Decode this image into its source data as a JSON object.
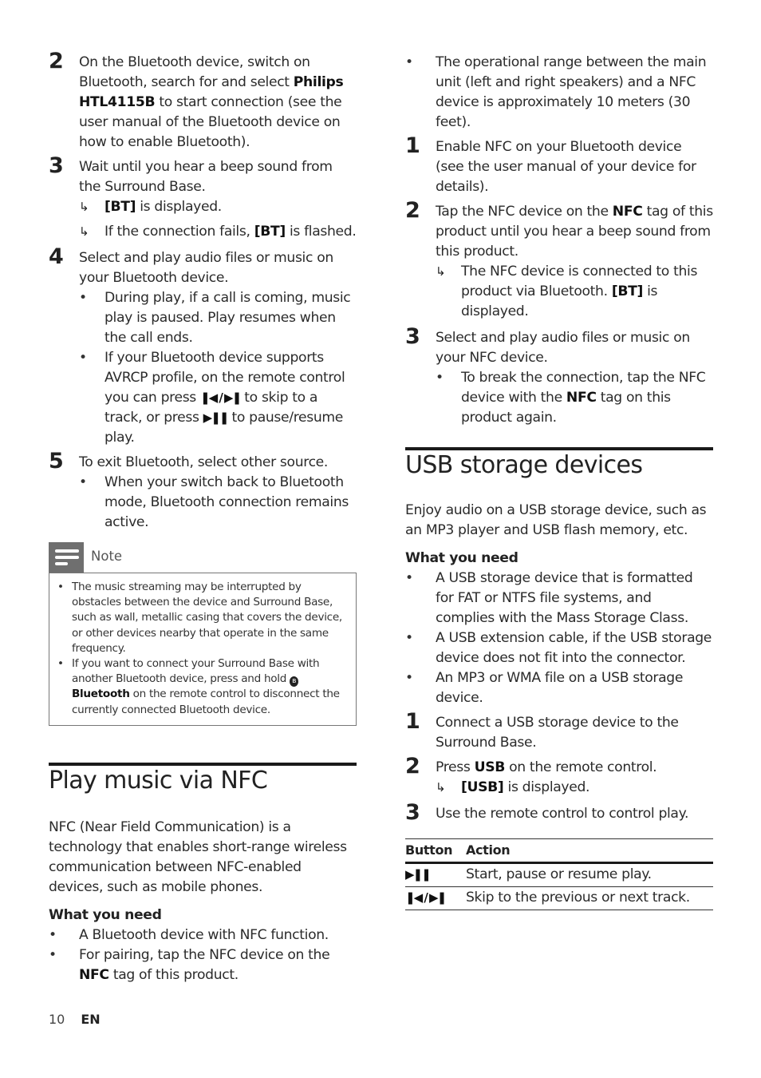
{
  "left_column": {
    "steps_bt": [
      {
        "num": "2",
        "parts": [
          "On the Bluetooth device, switch on Bluetooth, search for and select ",
          "Philips HTL4115B",
          " to start connection (see the user manual of the Bluetooth device on how to enable Bluetooth)."
        ]
      },
      {
        "num": "3",
        "text": "Wait until you hear a beep sound from the Surround Base.",
        "results": [
          {
            "bold": "[BT]",
            "text": " is displayed."
          },
          {
            "pre": "If the connection fails, ",
            "bold": "[BT]",
            "text": " is flashed."
          }
        ]
      },
      {
        "num": "4",
        "text": "Select and play audio files or music on your Bluetooth device.",
        "bullets": [
          "During play, if a call is coming, music play is paused. Play resumes when the call ends.",
          {
            "pre": "If your Bluetooth device supports AVRCP profile, on the remote control you can press ",
            "prev_next_icon": "prev-next-icon",
            "mid": " to skip to a track, or press ",
            "play_pause_icon": "play-pause-icon",
            "post": " to pause/resume play."
          }
        ]
      },
      {
        "num": "5",
        "text": "To exit Bluetooth, select other source.",
        "bullets": [
          "When your switch back to Bluetooth mode, Bluetooth connection remains active."
        ]
      }
    ],
    "note": {
      "title": "Note",
      "items": [
        "The music streaming may be interrupted by obstacles between the device and Surround Base, such as wall, metallic casing that covers the device, or other devices nearby that operate in the same frequency.",
        {
          "pre": "If you want to connect your Surround Base with another Bluetooth device, press and hold ",
          "bold": "Bluetooth",
          "post": " on the remote control to disconnect the currently connected Bluetooth device."
        }
      ]
    },
    "nfc_section": {
      "heading": "Play music via NFC",
      "intro": "NFC (Near Field Communication) is a technology that enables short-range wireless communication between NFC-enabled devices, such as mobile phones.",
      "subheading": "What you need",
      "needs": [
        "A Bluetooth device with NFC function.",
        {
          "pre": "For pairing, tap the NFC device on the ",
          "bold": "NFC",
          "post": " tag of this product."
        }
      ]
    }
  },
  "right_column": {
    "nfc_note": "The operational range between the main unit (left and right speakers) and a NFC device is approximately 10 meters (30 feet).",
    "nfc_steps": [
      {
        "num": "1",
        "text": "Enable NFC on your Bluetooth device (see the user manual of your device for details)."
      },
      {
        "num": "2",
        "pre": "Tap the NFC device on the ",
        "bold": "NFC",
        "post": " tag of this product until you hear a beep sound from this product.",
        "result": {
          "pre": "The NFC device is connected to this product via Bluetooth. ",
          "bold": "[BT]",
          "post": " is displayed."
        }
      },
      {
        "num": "3",
        "text": "Select and play audio files or music on your NFC device.",
        "bullet": {
          "pre": "To break the connection, tap the NFC device with the ",
          "bold": "NFC",
          "post": " tag on this product again."
        }
      }
    ],
    "usb_section": {
      "heading": "USB storage devices",
      "intro": "Enjoy audio on a USB storage device, such as an MP3 player and USB flash memory, etc.",
      "subheading": "What you need",
      "needs": [
        "A USB storage device that is formatted for FAT or NTFS file systems, and complies with the Mass Storage Class.",
        "A USB extension cable, if the USB storage device does not fit into the connector.",
        "An MP3 or WMA file on a USB storage device."
      ],
      "steps": [
        {
          "num": "1",
          "text": "Connect a USB storage device to the Surround Base."
        },
        {
          "num": "2",
          "pre": "Press ",
          "bold": "USB",
          "post": " on the remote control.",
          "result": {
            "bold": "[USB]",
            "post": " is displayed."
          }
        },
        {
          "num": "3",
          "text": "Use the remote control to control play."
        }
      ],
      "table": {
        "headers": [
          "Button",
          "Action"
        ],
        "rows": [
          {
            "button_icon": "play-pause-icon",
            "button": "▶❚❚",
            "action": "Start, pause or resume play."
          },
          {
            "button_icon": "prev-next-icon",
            "button": "❚◀ / ▶❚",
            "action": "Skip to the previous or next track."
          }
        ]
      }
    }
  },
  "footer": {
    "page_number": "10",
    "language": "EN"
  },
  "symbols": {
    "arrow": "↳",
    "bullet": "•",
    "play_pause": "▶❚❚",
    "prev_next": "❚◀ / ▶❚",
    "bt": "ʙ"
  }
}
